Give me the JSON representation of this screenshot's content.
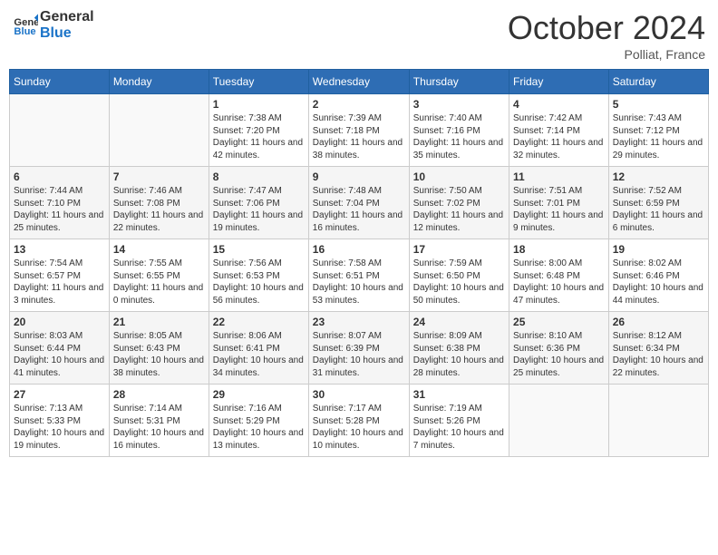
{
  "header": {
    "logo_line1": "General",
    "logo_line2": "Blue",
    "month_title": "October 2024",
    "subtitle": "Polliat, France"
  },
  "days_of_week": [
    "Sunday",
    "Monday",
    "Tuesday",
    "Wednesday",
    "Thursday",
    "Friday",
    "Saturday"
  ],
  "weeks": [
    [
      {
        "day": "",
        "info": ""
      },
      {
        "day": "",
        "info": ""
      },
      {
        "day": "1",
        "info": "Sunrise: 7:38 AM\nSunset: 7:20 PM\nDaylight: 11 hours and 42 minutes."
      },
      {
        "day": "2",
        "info": "Sunrise: 7:39 AM\nSunset: 7:18 PM\nDaylight: 11 hours and 38 minutes."
      },
      {
        "day": "3",
        "info": "Sunrise: 7:40 AM\nSunset: 7:16 PM\nDaylight: 11 hours and 35 minutes."
      },
      {
        "day": "4",
        "info": "Sunrise: 7:42 AM\nSunset: 7:14 PM\nDaylight: 11 hours and 32 minutes."
      },
      {
        "day": "5",
        "info": "Sunrise: 7:43 AM\nSunset: 7:12 PM\nDaylight: 11 hours and 29 minutes."
      }
    ],
    [
      {
        "day": "6",
        "info": "Sunrise: 7:44 AM\nSunset: 7:10 PM\nDaylight: 11 hours and 25 minutes."
      },
      {
        "day": "7",
        "info": "Sunrise: 7:46 AM\nSunset: 7:08 PM\nDaylight: 11 hours and 22 minutes."
      },
      {
        "day": "8",
        "info": "Sunrise: 7:47 AM\nSunset: 7:06 PM\nDaylight: 11 hours and 19 minutes."
      },
      {
        "day": "9",
        "info": "Sunrise: 7:48 AM\nSunset: 7:04 PM\nDaylight: 11 hours and 16 minutes."
      },
      {
        "day": "10",
        "info": "Sunrise: 7:50 AM\nSunset: 7:02 PM\nDaylight: 11 hours and 12 minutes."
      },
      {
        "day": "11",
        "info": "Sunrise: 7:51 AM\nSunset: 7:01 PM\nDaylight: 11 hours and 9 minutes."
      },
      {
        "day": "12",
        "info": "Sunrise: 7:52 AM\nSunset: 6:59 PM\nDaylight: 11 hours and 6 minutes."
      }
    ],
    [
      {
        "day": "13",
        "info": "Sunrise: 7:54 AM\nSunset: 6:57 PM\nDaylight: 11 hours and 3 minutes."
      },
      {
        "day": "14",
        "info": "Sunrise: 7:55 AM\nSunset: 6:55 PM\nDaylight: 11 hours and 0 minutes."
      },
      {
        "day": "15",
        "info": "Sunrise: 7:56 AM\nSunset: 6:53 PM\nDaylight: 10 hours and 56 minutes."
      },
      {
        "day": "16",
        "info": "Sunrise: 7:58 AM\nSunset: 6:51 PM\nDaylight: 10 hours and 53 minutes."
      },
      {
        "day": "17",
        "info": "Sunrise: 7:59 AM\nSunset: 6:50 PM\nDaylight: 10 hours and 50 minutes."
      },
      {
        "day": "18",
        "info": "Sunrise: 8:00 AM\nSunset: 6:48 PM\nDaylight: 10 hours and 47 minutes."
      },
      {
        "day": "19",
        "info": "Sunrise: 8:02 AM\nSunset: 6:46 PM\nDaylight: 10 hours and 44 minutes."
      }
    ],
    [
      {
        "day": "20",
        "info": "Sunrise: 8:03 AM\nSunset: 6:44 PM\nDaylight: 10 hours and 41 minutes."
      },
      {
        "day": "21",
        "info": "Sunrise: 8:05 AM\nSunset: 6:43 PM\nDaylight: 10 hours and 38 minutes."
      },
      {
        "day": "22",
        "info": "Sunrise: 8:06 AM\nSunset: 6:41 PM\nDaylight: 10 hours and 34 minutes."
      },
      {
        "day": "23",
        "info": "Sunrise: 8:07 AM\nSunset: 6:39 PM\nDaylight: 10 hours and 31 minutes."
      },
      {
        "day": "24",
        "info": "Sunrise: 8:09 AM\nSunset: 6:38 PM\nDaylight: 10 hours and 28 minutes."
      },
      {
        "day": "25",
        "info": "Sunrise: 8:10 AM\nSunset: 6:36 PM\nDaylight: 10 hours and 25 minutes."
      },
      {
        "day": "26",
        "info": "Sunrise: 8:12 AM\nSunset: 6:34 PM\nDaylight: 10 hours and 22 minutes."
      }
    ],
    [
      {
        "day": "27",
        "info": "Sunrise: 7:13 AM\nSunset: 5:33 PM\nDaylight: 10 hours and 19 minutes."
      },
      {
        "day": "28",
        "info": "Sunrise: 7:14 AM\nSunset: 5:31 PM\nDaylight: 10 hours and 16 minutes."
      },
      {
        "day": "29",
        "info": "Sunrise: 7:16 AM\nSunset: 5:29 PM\nDaylight: 10 hours and 13 minutes."
      },
      {
        "day": "30",
        "info": "Sunrise: 7:17 AM\nSunset: 5:28 PM\nDaylight: 10 hours and 10 minutes."
      },
      {
        "day": "31",
        "info": "Sunrise: 7:19 AM\nSunset: 5:26 PM\nDaylight: 10 hours and 7 minutes."
      },
      {
        "day": "",
        "info": ""
      },
      {
        "day": "",
        "info": ""
      }
    ]
  ]
}
